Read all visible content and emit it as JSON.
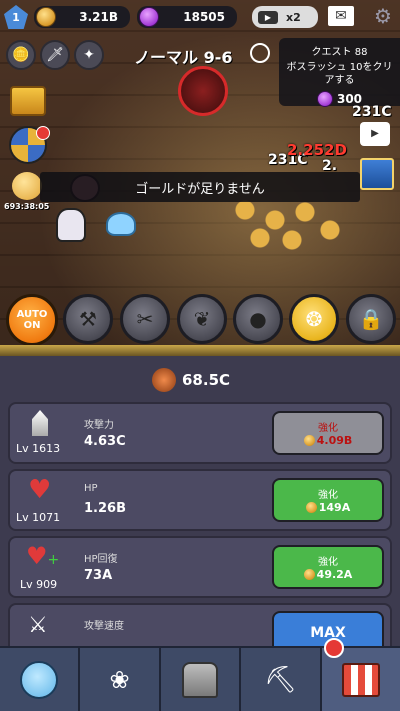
{
  "hud": {
    "level": "1",
    "gold": "3.21B",
    "gems": "18505",
    "video_multiplier": "x2",
    "stage_title": "ノーマル 9-6"
  },
  "quest": {
    "title": "クエスト 88",
    "description": "ボスラッシュ 10をクリアする",
    "reward": "300"
  },
  "scene": {
    "timer": "693:38:05",
    "floating_damage": [
      "231C",
      "231C",
      "2.252D",
      "2."
    ],
    "toast": "ゴールドが足りません"
  },
  "skills": {
    "auto_label_top": "AUTO",
    "auto_label_bottom": "ON"
  },
  "total_power": "68.5C",
  "upgrades": [
    {
      "level": "Lv 1613",
      "label": "攻撃力",
      "value": "4.63C",
      "button_label": "強化",
      "cost": "4.09B",
      "state": "gray"
    },
    {
      "level": "Lv 1071",
      "label": "HP",
      "value": "1.26B",
      "button_label": "強化",
      "cost": "149A",
      "state": "green"
    },
    {
      "level": "Lv 909",
      "label": "HP回復",
      "value": "73A",
      "button_label": "強化",
      "cost": "49.2A",
      "state": "green"
    },
    {
      "level": "",
      "label": "攻撃速度",
      "value": "",
      "button_label": "MAX",
      "cost": "",
      "state": "blue"
    }
  ],
  "colors": {
    "gray_button": "#8f8f97",
    "green_button": "#4bb84a",
    "blue_button": "#3a7ed8",
    "damage_red": "#ff3b30"
  }
}
